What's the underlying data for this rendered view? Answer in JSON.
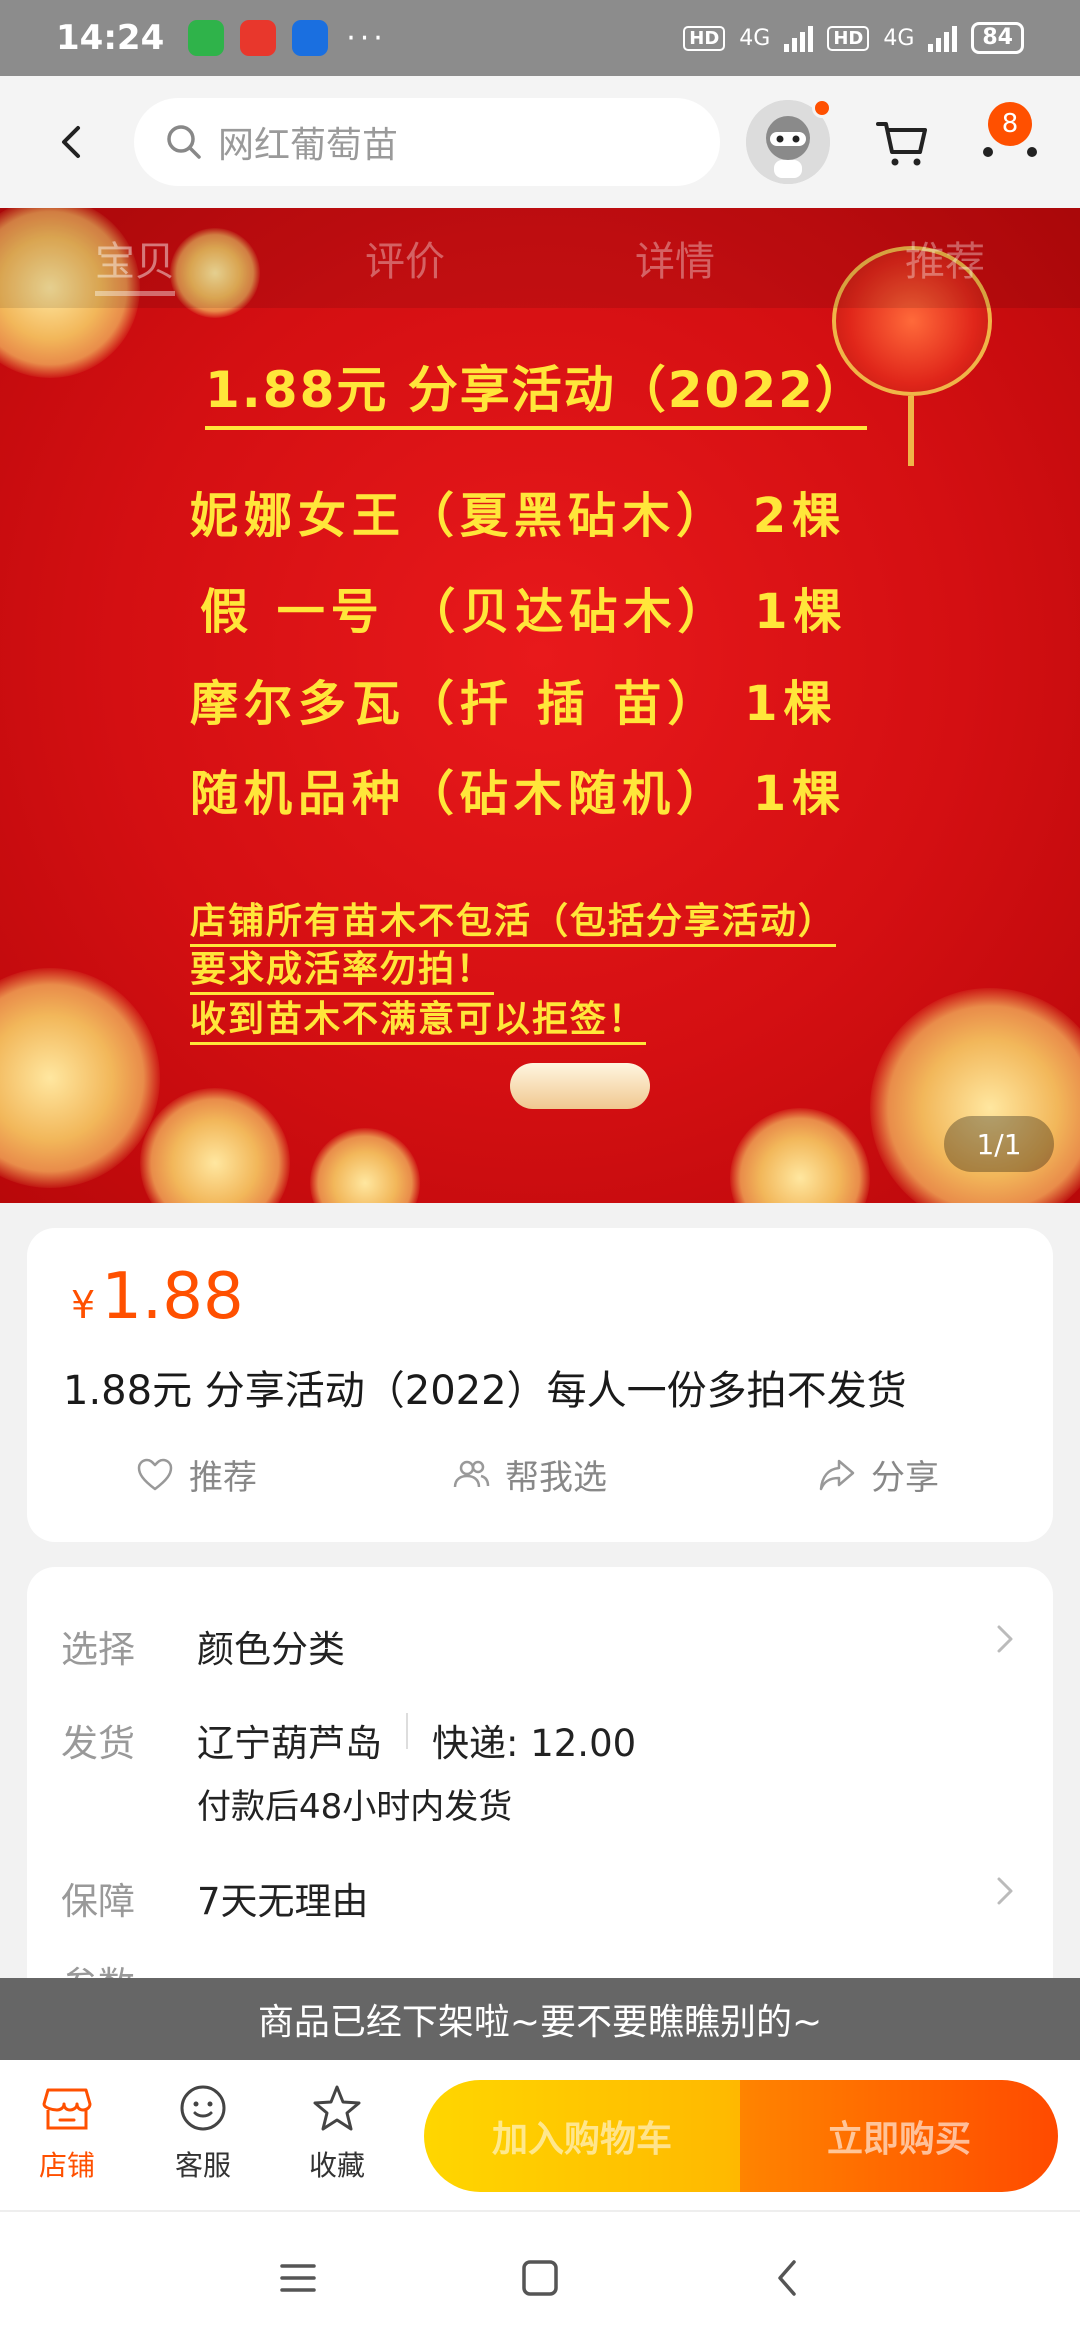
{
  "status_bar": {
    "time": "14:24",
    "network_1": "4G",
    "network_2": "4G",
    "hd": "HD",
    "battery": "84",
    "more": "···"
  },
  "header": {
    "search_placeholder": "网红葡萄苗",
    "message_badge": "8"
  },
  "hero": {
    "tabs": [
      "宝贝",
      "评价",
      "详情",
      "推荐"
    ],
    "poster": {
      "title": "1.88元 分享活动（2022）",
      "lines": [
        "妮娜女王（夏黑砧木） 2棵",
        "假 一号 （贝达砧木） 1棵",
        "摩尔多瓦（扦 插 苗） 1棵",
        "随机品种（砧木随机） 1棵"
      ],
      "notes": [
        "店铺所有苗木不包活（包括分享活动）",
        "要求成活率勿拍！",
        "收到苗木不满意可以拒签！"
      ]
    },
    "image_counter": "1/1"
  },
  "product": {
    "currency": "¥",
    "price": "1.88",
    "title": "1.88元 分享活动（2022）每人一份多拍不发货",
    "actions": {
      "recommend": "推荐",
      "help_choose": "帮我选",
      "share": "分享"
    }
  },
  "info": {
    "select_label": "选择",
    "select_value": "颜色分类",
    "ship_label": "发货",
    "ship_from": "辽宁葫芦岛",
    "ship_fee": "快递: 12.00",
    "ship_time": "付款后48小时内发货",
    "guarantee_label": "保障",
    "guarantee_value": "7天无理由",
    "params_label": "参数"
  },
  "banner": {
    "offline_text": "商品已经下架啦~要不要瞧瞧别的~"
  },
  "bottom_bar": {
    "store": "店铺",
    "service": "客服",
    "favorite": "收藏",
    "add_to_cart": "加入购物车",
    "buy_now": "立即购买"
  },
  "colors": {
    "accent": "#ff5000",
    "poster_red": "#d40f12",
    "poster_gold": "#ffe63a"
  }
}
